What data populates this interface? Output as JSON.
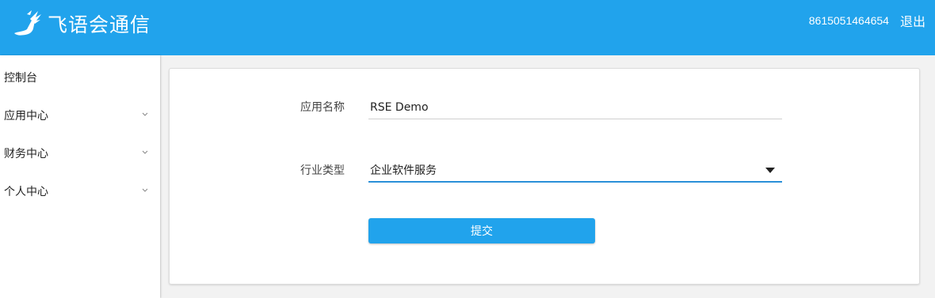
{
  "header": {
    "logo_text": "飞语会通信",
    "phone": "8615051464654",
    "logout_label": "退出"
  },
  "sidebar": {
    "items": [
      {
        "label": "控制台",
        "expandable": false
      },
      {
        "label": "应用中心",
        "expandable": true
      },
      {
        "label": "财务中心",
        "expandable": true
      },
      {
        "label": "个人中心",
        "expandable": true
      }
    ]
  },
  "form": {
    "app_name_label": "应用名称",
    "app_name_value": "RSE Demo",
    "industry_label": "行业类型",
    "industry_value": "企业软件服务",
    "submit_label": "提交"
  },
  "colors": {
    "accent": "#21a3ec",
    "select_underline": "#2a8fd8"
  }
}
